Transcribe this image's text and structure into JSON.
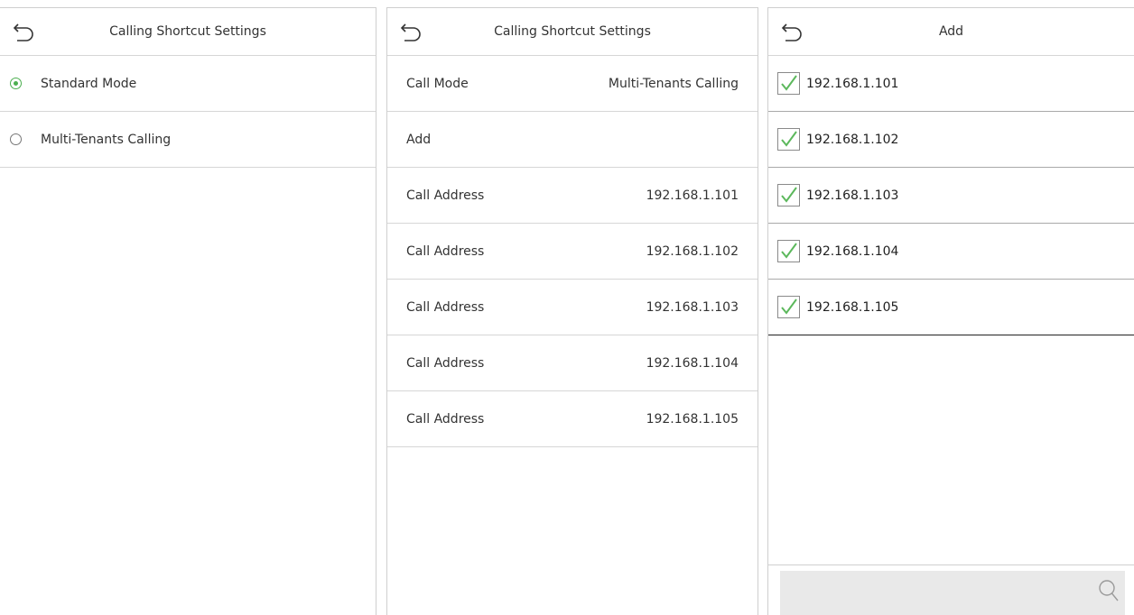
{
  "panel1": {
    "title": "Calling Shortcut Settings",
    "options": [
      {
        "label": "Standard Mode",
        "selected": true
      },
      {
        "label": "Multi-Tenants Calling",
        "selected": false
      }
    ]
  },
  "panel2": {
    "title": "Calling Shortcut Settings",
    "rows": [
      {
        "label": "Call Mode",
        "value": "Multi-Tenants Calling"
      },
      {
        "label": "Add",
        "value": ""
      },
      {
        "label": "Call Address",
        "value": "192.168.1.101"
      },
      {
        "label": "Call Address",
        "value": "192.168.1.102"
      },
      {
        "label": "Call Address",
        "value": "192.168.1.103"
      },
      {
        "label": "Call Address",
        "value": "192.168.1.104"
      },
      {
        "label": "Call Address",
        "value": "192.168.1.105"
      }
    ]
  },
  "panel3": {
    "title": "Add",
    "items": [
      {
        "label": "192.168.1.101",
        "checked": true
      },
      {
        "label": "192.168.1.102",
        "checked": true
      },
      {
        "label": "192.168.1.103",
        "checked": true
      },
      {
        "label": "192.168.1.104",
        "checked": true
      },
      {
        "label": "192.168.1.105",
        "checked": true
      }
    ],
    "search_placeholder": ""
  },
  "icons": {
    "back": "back-arrow-icon",
    "check": "checkmark-icon",
    "search": "search-icon"
  },
  "colors": {
    "accent_green": "#4caf50",
    "divider": "#d6d6d6"
  }
}
